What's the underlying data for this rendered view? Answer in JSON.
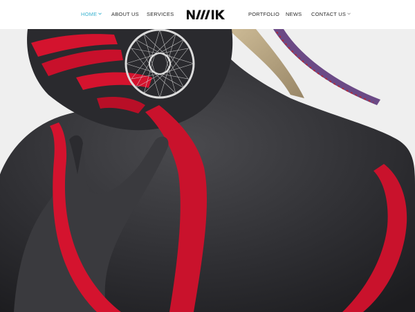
{
  "nav": {
    "home": "HOME",
    "about": "ABOUT US",
    "services": "SERVICES",
    "portfolio": "PORTFOLIO",
    "news": "NEWS",
    "contact": "CONTACT US"
  },
  "logo": {
    "text": "NMIK"
  },
  "colors": {
    "accent": "#39b3d0",
    "text": "#2b2b2b",
    "background": "#ffffff",
    "hero_background": "#efefef",
    "paint_red": "#d4132e"
  },
  "icons": {
    "dropdown": "chevron-down-icon"
  }
}
